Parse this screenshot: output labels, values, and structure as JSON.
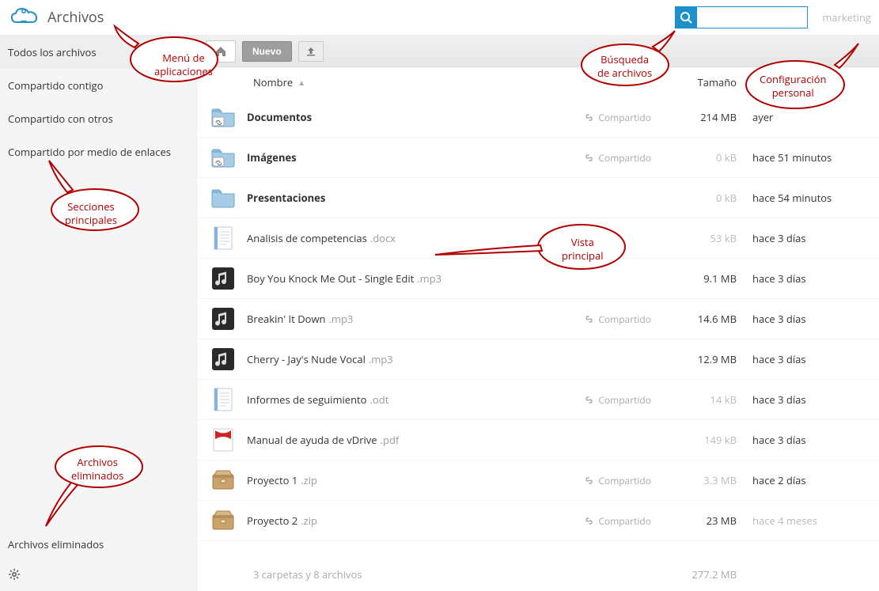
{
  "header": {
    "app_title": "Archivos",
    "user": "marketing",
    "search_placeholder": ""
  },
  "sidebar": {
    "items": [
      {
        "label": "Todos los archivos",
        "active": true
      },
      {
        "label": "Compartido contigo",
        "active": false
      },
      {
        "label": "Compartido con otros",
        "active": false
      },
      {
        "label": "Compartido por medio de enlaces",
        "active": false
      }
    ],
    "trash_label": "Archivos eliminados"
  },
  "toolbar": {
    "new_label": "Nuevo"
  },
  "columns": {
    "name": "Nombre",
    "size": "Tamaño",
    "modified": ""
  },
  "share_label": "Compartido",
  "files": [
    {
      "icon": "folder-link",
      "name": "Documentos",
      "ext": "",
      "bold": true,
      "shared": true,
      "size": "214 MB",
      "size_dim": false,
      "mod": "ayer",
      "mod_dim": false
    },
    {
      "icon": "folder-link",
      "name": "Imágenes",
      "ext": "",
      "bold": true,
      "shared": true,
      "size": "0 kB",
      "size_dim": true,
      "mod": "hace 51 minutos",
      "mod_dim": false
    },
    {
      "icon": "folder",
      "name": "Presentaciones",
      "ext": "",
      "bold": true,
      "shared": false,
      "size": "0 kB",
      "size_dim": true,
      "mod": "hace 54 minutos",
      "mod_dim": false
    },
    {
      "icon": "doc",
      "name": "Analisis de competencias",
      "ext": ".docx",
      "bold": false,
      "shared": false,
      "size": "53 kB",
      "size_dim": true,
      "mod": "hace 3 días",
      "mod_dim": false
    },
    {
      "icon": "music",
      "name": "Boy You Knock Me Out - Single Edit",
      "ext": ".mp3",
      "bold": false,
      "shared": false,
      "size": "9.1 MB",
      "size_dim": false,
      "mod": "hace 3 días",
      "mod_dim": false
    },
    {
      "icon": "music",
      "name": "Breakin' It Down",
      "ext": ".mp3",
      "bold": false,
      "shared": true,
      "size": "14.6 MB",
      "size_dim": false,
      "mod": "hace 3 días",
      "mod_dim": false
    },
    {
      "icon": "music",
      "name": "Cherry - Jay's Nude Vocal",
      "ext": ".mp3",
      "bold": false,
      "shared": false,
      "size": "12.9 MB",
      "size_dim": false,
      "mod": "hace 3 días",
      "mod_dim": false
    },
    {
      "icon": "doc",
      "name": "Informes de seguimiento",
      "ext": ".odt",
      "bold": false,
      "shared": true,
      "size": "14 kB",
      "size_dim": true,
      "mod": "hace 3 días",
      "mod_dim": false
    },
    {
      "icon": "pdf",
      "name": "Manual de ayuda de vDrive",
      "ext": ".pdf",
      "bold": false,
      "shared": false,
      "size": "149 kB",
      "size_dim": true,
      "mod": "hace 3 días",
      "mod_dim": false
    },
    {
      "icon": "zip",
      "name": "Proyecto 1",
      "ext": ".zip",
      "bold": false,
      "shared": true,
      "size": "3.3 MB",
      "size_dim": true,
      "mod": "hace 2 días",
      "mod_dim": false
    },
    {
      "icon": "zip",
      "name": "Proyecto 2",
      "ext": ".zip",
      "bold": false,
      "shared": true,
      "size": "23 MB",
      "size_dim": false,
      "mod": "hace 4 meses",
      "mod_dim": true
    }
  ],
  "summary": {
    "count": "3 carpetas y 8 archivos",
    "total": "277.2 MB"
  },
  "callouts": {
    "apps_menu": "Menú de\naplicaciones",
    "file_search": "Búsqueda\nde archivos",
    "personal_config": "Configuración\npersonal",
    "main_sections": "Secciones\nprincipales",
    "main_view": "Vista\nprincipal",
    "deleted_files": "Archivos\neliminados"
  }
}
